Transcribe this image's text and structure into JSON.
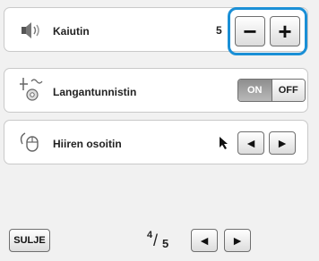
{
  "settings": [
    {
      "label": "Kaiutin",
      "icon": "speaker-icon",
      "level": "5",
      "minus": "−",
      "plus": "+"
    },
    {
      "label": "Langantunnistin",
      "icon": "thread-sensor-icon",
      "on": "ON",
      "off": "OFF",
      "state": "ON"
    },
    {
      "label": "Hiiren osoitin",
      "icon": "mouse-icon",
      "prev": "◄",
      "next": "►"
    }
  ],
  "footer": {
    "close_label": "SULJE",
    "page_current": "4",
    "page_total": "5",
    "prev": "◄",
    "next": "►"
  },
  "colors": {
    "highlight": "#1a8fd6"
  }
}
